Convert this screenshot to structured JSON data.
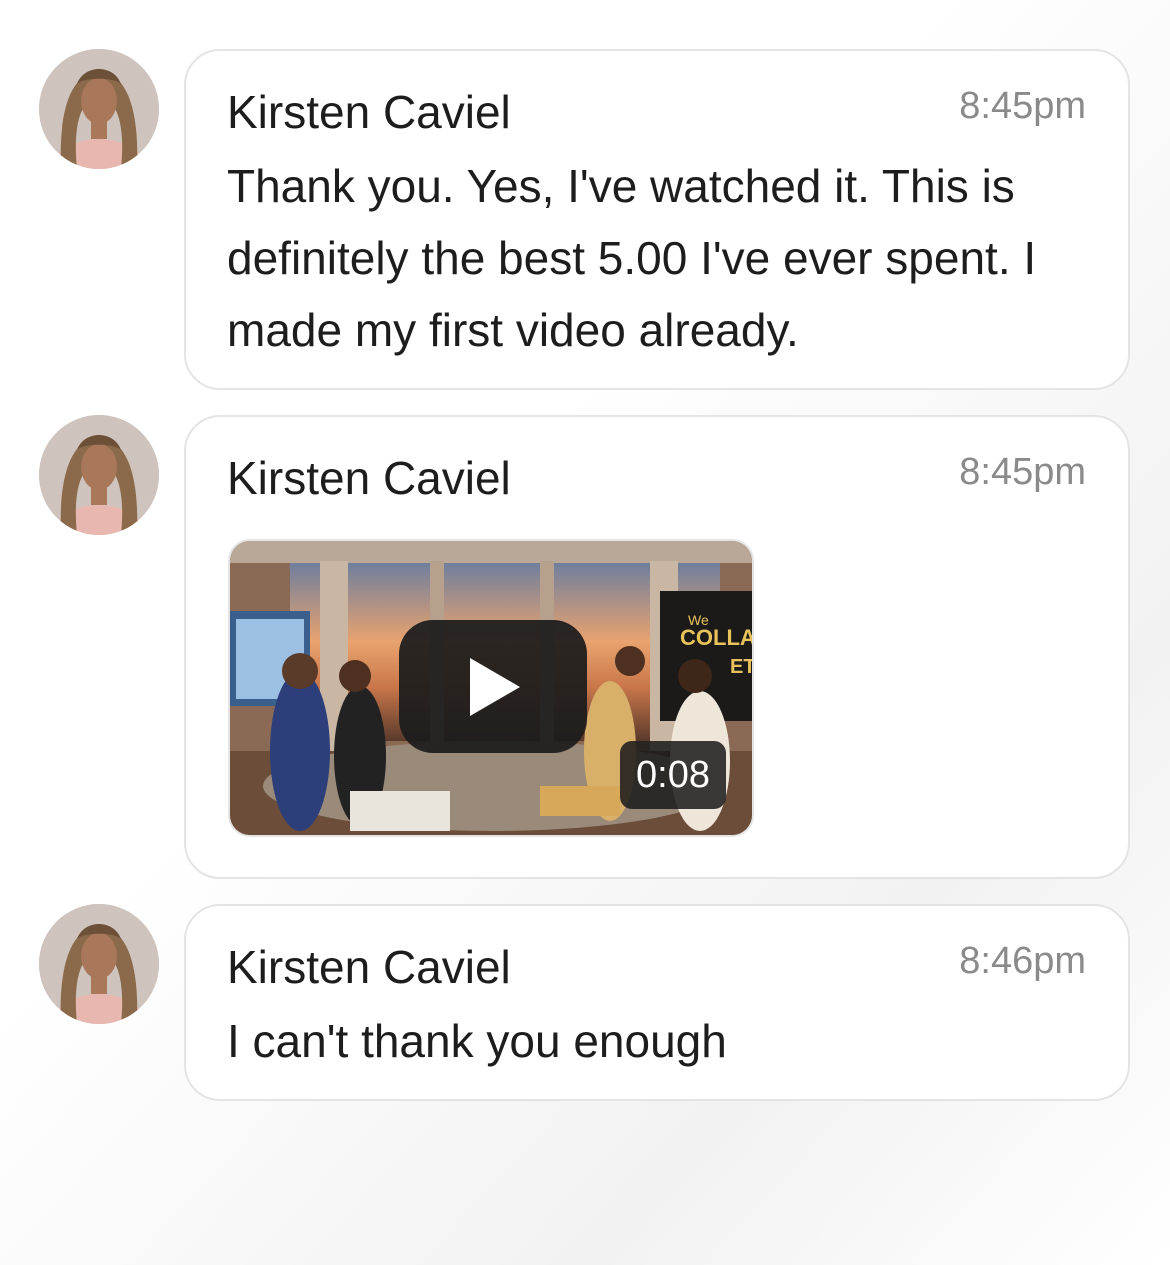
{
  "messages": [
    {
      "sender": "Kirsten Caviel",
      "time": "8:45pm",
      "text": "Thank you. Yes, I've watched it. This is definitely the best 5.00 I've ever spent. I made my first video already."
    },
    {
      "sender": "Kirsten Caviel",
      "time": "8:45pm",
      "video": {
        "duration": "0:08",
        "sign_text_line1": "We",
        "sign_text_line2": "COLLA",
        "sign_text_line3": "ET",
        "play_icon": "play-icon"
      }
    },
    {
      "sender": "Kirsten Caviel",
      "time": "8:46pm",
      "text": "I can't thank you enough"
    }
  ],
  "avatar_icon": "user-avatar-photo"
}
